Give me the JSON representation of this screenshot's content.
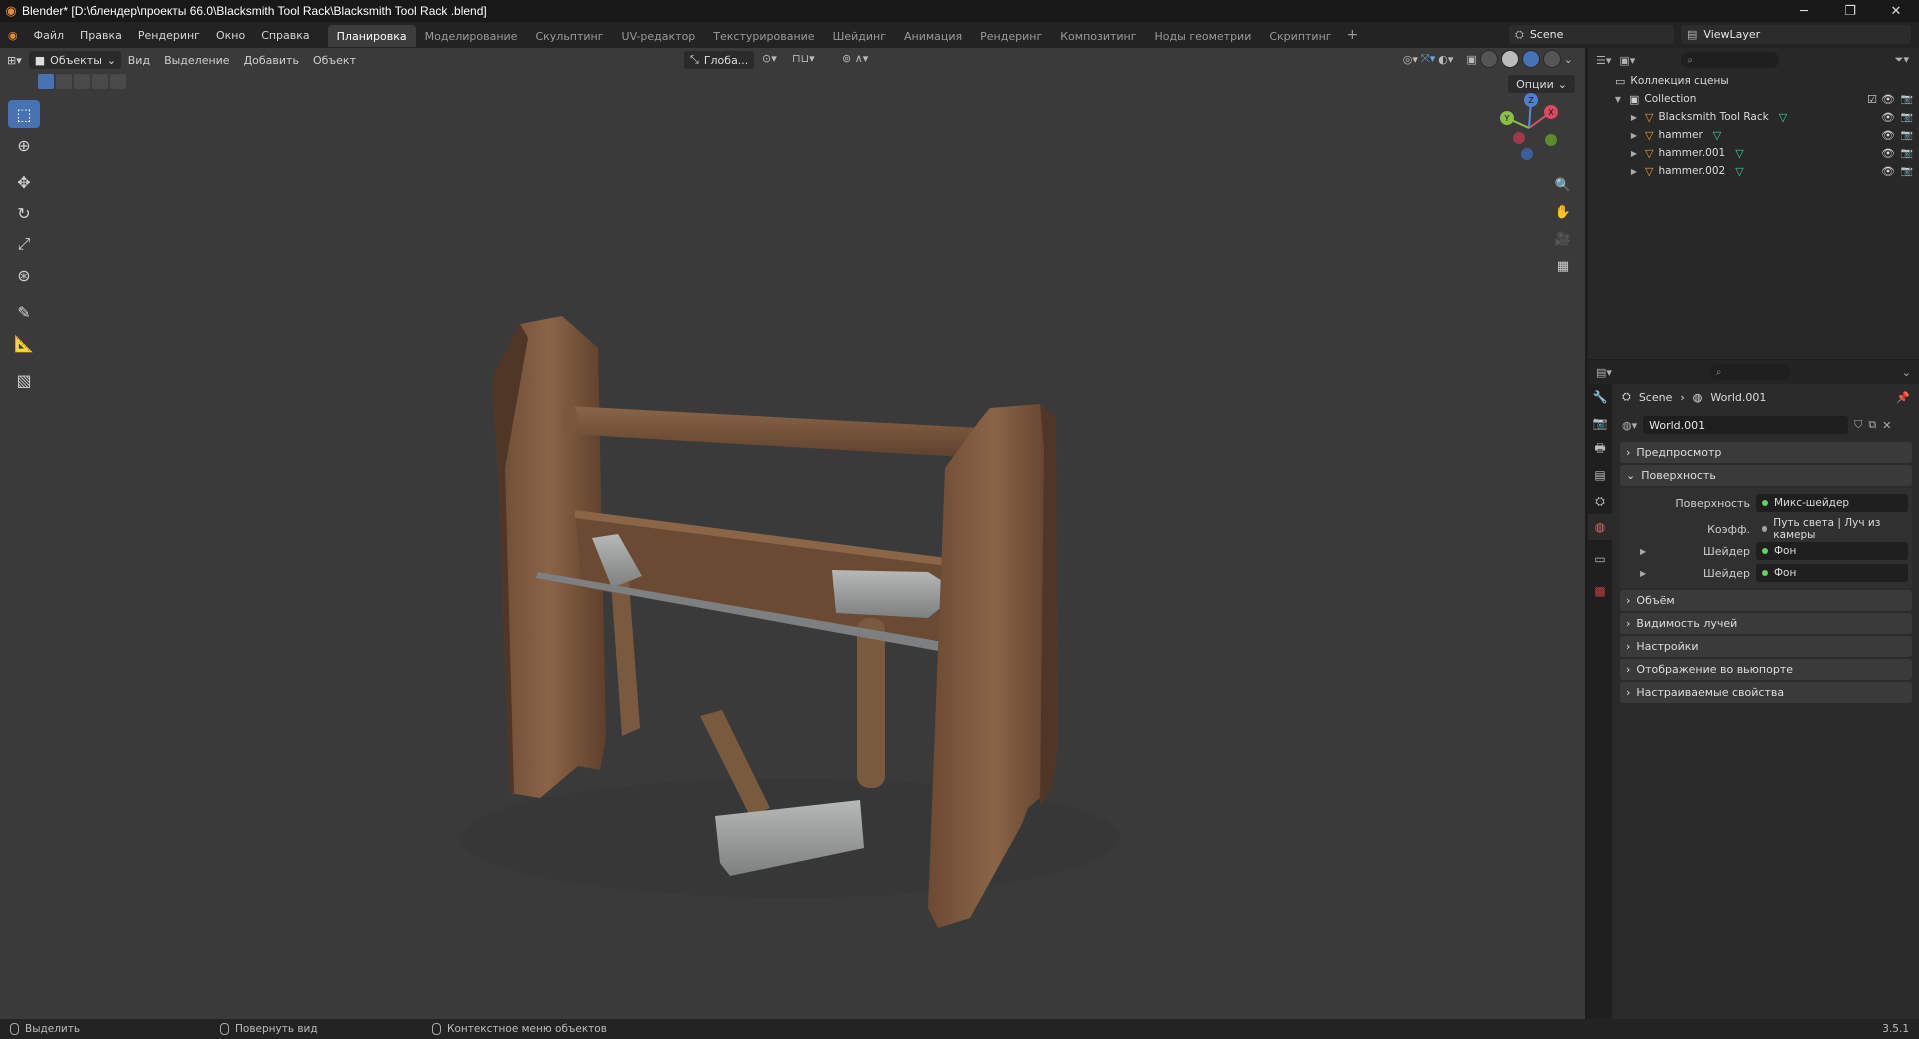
{
  "window": {
    "title": "Blender* [D:\\блендер\\проекты 66.0\\Blacksmith Tool Rack\\Blacksmith Tool Rack .blend]",
    "minimize": "─",
    "maximize": "❐",
    "close": "✕"
  },
  "menus": [
    "Файл",
    "Правка",
    "Рендеринг",
    "Окно",
    "Справка"
  ],
  "workspaces": [
    {
      "label": "Планировка",
      "active": true
    },
    {
      "label": "Моделирование"
    },
    {
      "label": "Скульптинг"
    },
    {
      "label": "UV-редактор"
    },
    {
      "label": "Текстурирование"
    },
    {
      "label": "Шейдинг"
    },
    {
      "label": "Анимация"
    },
    {
      "label": "Рендеринг"
    },
    {
      "label": "Композитинг"
    },
    {
      "label": "Ноды геометрии"
    },
    {
      "label": "Скриптинг"
    }
  ],
  "workspace_add": "+",
  "scene_selector": "Scene",
  "viewlayer_selector": "ViewLayer",
  "viewport": {
    "mode": "Объекты",
    "menus": [
      "Вид",
      "Выделение",
      "Добавить",
      "Объект"
    ],
    "orientation": "Глоба...",
    "options": "Опции",
    "gizmo_axes": [
      "X",
      "Y",
      "Z"
    ]
  },
  "outliner": {
    "root": "Коллекция сцены",
    "collection": "Collection",
    "objects": [
      "Blacksmith Tool Rack",
      "hammer",
      "hammer.001",
      "hammer.002"
    ]
  },
  "properties": {
    "breadcrumb_scene": "Scene",
    "breadcrumb_world": "World.001",
    "world_name": "World.001",
    "panels": {
      "preview": "Предпросмотр",
      "surface": "Поверхность",
      "volume": "Объём",
      "ray_visibility": "Видимость лучей",
      "settings": "Настройки",
      "viewport_display": "Отображение во вьюпорте",
      "custom_props": "Настраиваемые свойства"
    },
    "surface": {
      "surface_label": "Поверхность",
      "surface_value": "Микс-шейдер",
      "factor_label": "Коэфф.",
      "factor_value": "Путь света | Луч из камеры",
      "shader1_label": "Шейдер",
      "shader1_value": "Фон",
      "shader2_label": "Шейдер",
      "shader2_value": "Фон"
    }
  },
  "statusbar": {
    "select": "Выделить",
    "rotate": "Повернуть вид",
    "context": "Контекстное меню объектов",
    "version": "3.5.1"
  },
  "colors": {
    "accent": "#4772b3",
    "object_icon": "#f0a030",
    "mesh_icon": "#3cd2a6",
    "viewport_bg": "#3a3a3a"
  }
}
